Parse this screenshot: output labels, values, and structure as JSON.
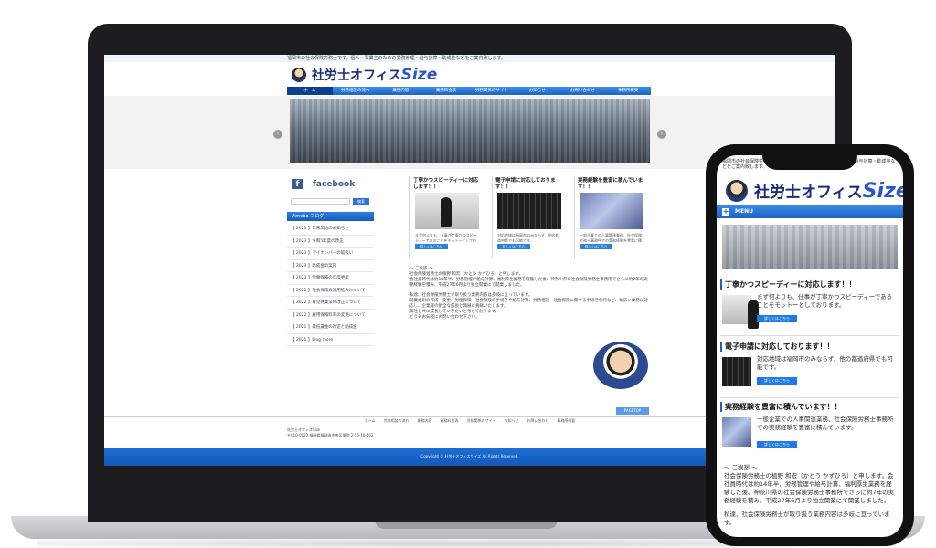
{
  "desktop": {
    "topline": "福岡市の社会保険労務士です。個人・事業主のための労務管理・給与計算・助成金などをご案内致します。",
    "logo": {
      "prefix": "社労士オフィス",
      "brand": "Size"
    },
    "nav": [
      "ホーム",
      "労務相談の流れ",
      "業務内容",
      "業務料金表",
      "労務関係のサイト",
      "お知らせ",
      "お問い合わせ",
      "事務所概要"
    ],
    "hero_prev": "‹",
    "hero_next": "›",
    "facebook": {
      "mark": "f",
      "label": "facebook"
    },
    "search_button": "検索",
    "ameba_heading": "Ameba ブログ",
    "blog_items": [
      "【 2023 】年末年始のお知らせ",
      "【 2023 】令和5年度の改正",
      "【 2023 】マイナンバーの取扱い",
      "【 2023 】助成金の案内",
      "【 2023 】労働保険の年度更新",
      "【 2022 】社会保険の適用拡大について",
      "【 2022 】育児休業法の改正について",
      "【 2022 】雇用保険料率の変更について",
      "【 2021 】最低賃金の改定と助成金",
      "【 2021 】blog more"
    ],
    "cards": [
      {
        "title": "丁寧かつスピーディーに対応します！！",
        "desc": "まず何よりも、仕事が丁寧かつスピーディーであることをモットーとしております。",
        "btn": "詳しくはこちら"
      },
      {
        "title": "電子申請に対応しております！！",
        "desc": "対応地域は福岡市のみならず、他の都道府県でも可能です。",
        "btn": "詳しくはこちら"
      },
      {
        "title": "実務経験を豊富に積んでいます！！",
        "desc": "一般企業での人事関連業務、社会保険労務士事務所での実務経験を豊富に積んでいます。",
        "btn": "詳しくはこちら"
      }
    ],
    "greeting_title": "～ ご挨拶 ～",
    "greeting_lines": [
      "社会保険労務士の植野 和宏（かとう かずひろ）と申します。",
      "会社員時代は約14年半、労務管理や給与計算、福利厚生業務を経験した後、神奈川県の社会保険労務士事務所でさらに約7年の実務経験を積み、平成27年6月より独立開業にて開業しました。",
      "私達、社会保険労務士が取り扱う業務内容は多岐に亘っています。",
      "就業規則の作成・変更、労働保険・社会保険の手続きや給与計算、労務相談・社会保険に関する手続き代行など、幅広い業務に対応し、企業様の健全な成長と発展に貢献いたします。",
      "御社と共に成長していきたいと考えております。",
      "どうぞお気軽にお問い合わせ下さい。"
    ],
    "pagetop": "PAGETOP",
    "footnav": [
      "ホーム",
      "労務相談の流れ",
      "業務内容",
      "業務料金表",
      "労務関係のサイト",
      "お知らせ",
      "お問い合わせ",
      "事務所概要"
    ],
    "footinfo_name": "社労士オフィスSize",
    "footinfo_addr": "〒810-0022 福岡県福岡市中央区薬院 2-15-10-402",
    "copyright": "Copyright © 社労士オフィスサイズ All Rights Reserved."
  },
  "mobile": {
    "topline": "福岡市の社会保険労務士です。個人・事業主のための労務管理・給与計算・助成金などをご案内致します。",
    "logo": {
      "prefix": "社労士オフィス",
      "brand": "Size"
    },
    "menu_label": "MENU",
    "menu_icon": "+",
    "sections": [
      {
        "heading": "丁寧かつスピーディーに対応します！！",
        "text": "まず何よりも、仕事が丁寧かつスピーディーであることをモットーとしております。",
        "btn": "詳しくはこちら"
      },
      {
        "heading": "電子申請に対応しております！！",
        "text": "対応地域は福岡市のみならず、他の都道府県でも可能です。",
        "btn": "詳しくはこちら"
      },
      {
        "heading": "実務経験を豊富に積んでいます！！",
        "text": "一般企業での人事関連業務、社会保険労務士事務所での実務経験を豊富に積んでいます。",
        "btn": "詳しくはこちら"
      }
    ],
    "greeting_title": "～ ご挨拶 ～",
    "greeting_p1": "社会保険労務士の植野 和宏（かとう かずひろ）と申します。会社員時代は約14年半、労務管理や給与計算、福利厚生業務を経験した後、神奈川県の社会保険労務士事務所でさらに約7年の実務経験を積み、平成27年6月より独立開業にて開業しました。",
    "greeting_p2": "私達、社会保険労務士が取り扱う業務内容は多岐に亘っています。"
  }
}
